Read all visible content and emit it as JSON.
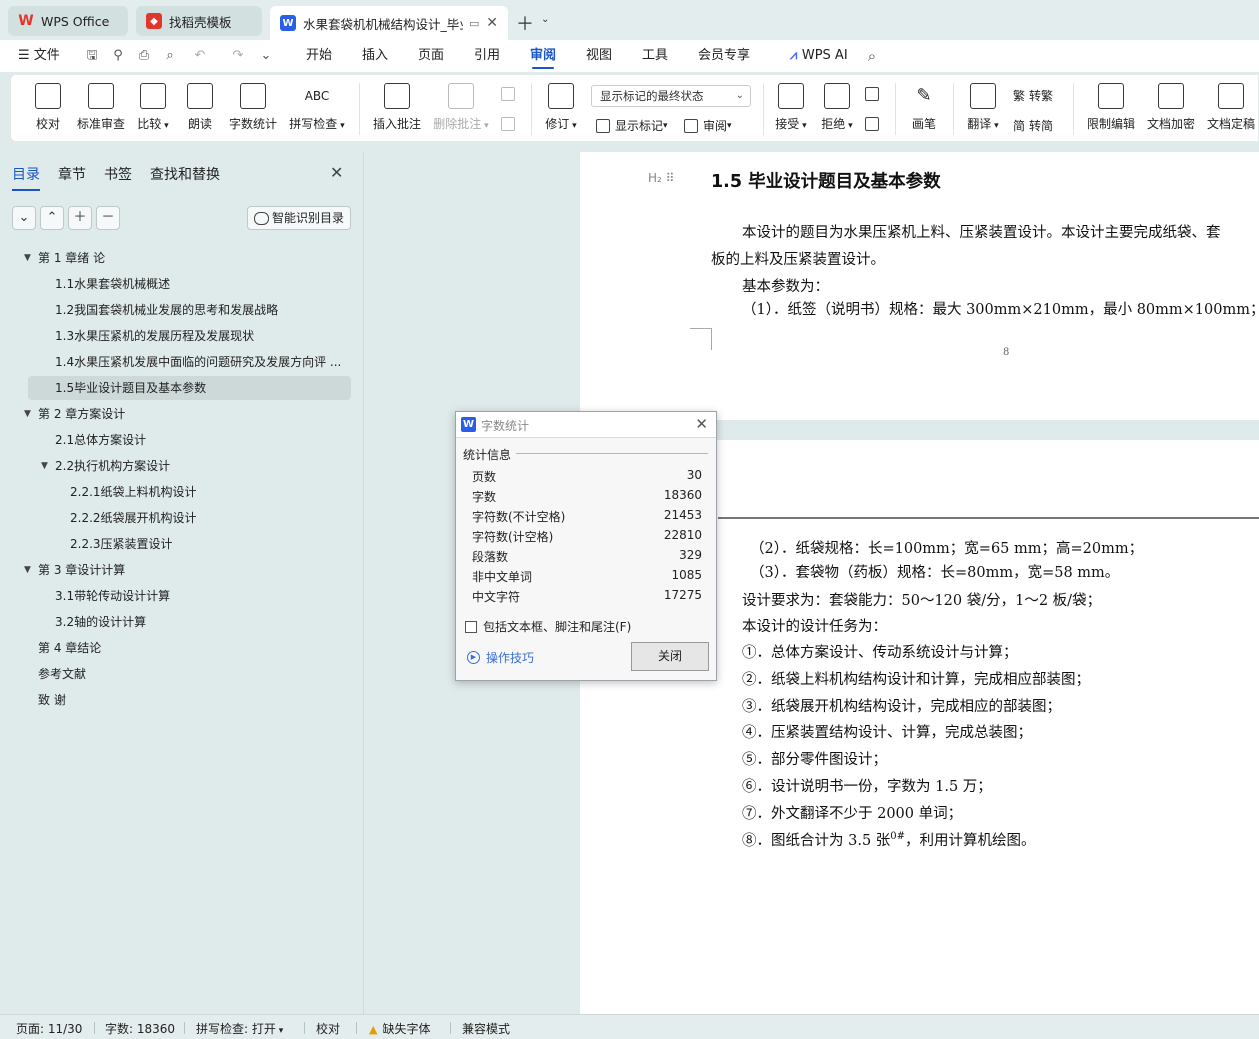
{
  "tabs": [
    {
      "label": "WPS Office",
      "icon": "wps-logo-icon"
    },
    {
      "label": "找稻壳模板",
      "icon": "docer-logo-icon"
    },
    {
      "label": "水果套袋机机械结构设计_毕业",
      "icon": "writer-logo-icon"
    }
  ],
  "menu": {
    "file": "文件",
    "items": [
      "开始",
      "插入",
      "页面",
      "引用",
      "审阅",
      "视图",
      "工具",
      "会员专享"
    ],
    "active": "审阅",
    "wps_ai": "WPS AI"
  },
  "ribbon": {
    "proofread": "校对",
    "standard_review": "标准审查",
    "compare": "比较",
    "read_aloud": "朗读",
    "word_count": "字数统计",
    "spell_check": "拼写检查",
    "insert_comment": "插入批注",
    "delete_comment": "删除批注",
    "track_changes": "修订",
    "display_state": "显示标记的最终状态",
    "show_markup": "显示标记",
    "review": "审阅",
    "accept": "接受",
    "reject": "拒绝",
    "pen": "画笔",
    "translate": "翻译",
    "to_traditional": "转繁",
    "to_simplified": "转简",
    "restrict_edit": "限制编辑",
    "doc_encrypt": "文档加密",
    "doc_finalize": "文档定稿"
  },
  "nav": {
    "tabs": [
      "目录",
      "章节",
      "书签",
      "查找和替换"
    ],
    "smart_toc": "智能识别目录",
    "toc": [
      {
        "label": "第 1 章绪  论",
        "level": 1,
        "caret": true
      },
      {
        "label": "1.1水果套袋机械概述",
        "level": 2
      },
      {
        "label": "1.2我国套袋机械业发展的思考和发展战略",
        "level": 2
      },
      {
        "label": "1.3水果压紧机的发展历程及发展现状",
        "level": 2
      },
      {
        "label": "1.4水果压紧机发展中面临的问题研究及发展方向评 ...",
        "level": 2
      },
      {
        "label": "1.5毕业设计题目及基本参数",
        "level": 2,
        "selected": true
      },
      {
        "label": "第 2 章方案设计",
        "level": 1,
        "caret": true
      },
      {
        "label": "2.1总体方案设计",
        "level": 2
      },
      {
        "label": "2.2执行机构方案设计",
        "level": 2,
        "caret": true
      },
      {
        "label": "2.2.1纸袋上料机构设计",
        "level": 3
      },
      {
        "label": "2.2.2纸袋展开机构设计",
        "level": 3
      },
      {
        "label": "2.2.3压紧装置设计",
        "level": 3
      },
      {
        "label": "第 3 章设计计算",
        "level": 1,
        "caret": true
      },
      {
        "label": "3.1带轮传动设计计算",
        "level": 2
      },
      {
        "label": "3.2轴的设计计算",
        "level": 2
      },
      {
        "label": "第 4 章结论",
        "level": 1
      },
      {
        "label": "参考文献",
        "level": 1
      },
      {
        "label": "致  谢",
        "level": 1
      }
    ]
  },
  "document": {
    "heading_mark": "H₂",
    "heading": "1.5  毕业设计题目及基本参数",
    "p1_line1": "本设计的题目为水果压紧机上料、压紧装置设计。本设计主要完成纸袋、套",
    "p1_line2": "板的上料及压紧装置设计。",
    "p2": "基本参数为：",
    "p3": "（1）．纸签（说明书）规格：最大 300mm×210mm，最小 80mm×100mm；",
    "page_number": "8",
    "page2_lines": [
      "（2）．纸袋规格：长=100mm；宽=65 mm；高=20mm；",
      "（3）．套袋物（药板）规格：长=80mm，宽=58 mm。",
      "设计要求为：套袋能力：50～120 袋/分，1～2 板/袋；",
      "本设计的设计任务为：",
      "①．总体方案设计、传动系统设计与计算；",
      "②．纸袋上料机构结构设计和计算，完成相应部装图；",
      "③．纸袋展开机构结构设计，完成相应的部装图；",
      "④．压紧装置结构设计、计算，完成总装图；",
      "⑤．部分零件图设计；",
      "⑥．设计说明书一份，字数为 1.5 万；",
      "⑦．外文翻译不少于 2000 单词；"
    ],
    "last_line_before": "⑧．图纸合计为 3.5 张",
    "last_line_sup": "0#",
    "last_line_after": "，利用计算机绘图。"
  },
  "dialog": {
    "title": "字数统计",
    "section": "统计信息",
    "stats": [
      {
        "label": "页数",
        "value": "30"
      },
      {
        "label": "字数",
        "value": "18360"
      },
      {
        "label": "字符数(不计空格)",
        "value": "21453"
      },
      {
        "label": "字符数(计空格)",
        "value": "22810"
      },
      {
        "label": "段落数",
        "value": "329"
      },
      {
        "label": "非中文单词",
        "value": "1085"
      },
      {
        "label": "中文字符",
        "value": "17275"
      }
    ],
    "checkbox": "包括文本框、脚注和尾注(F)",
    "tips": "操作技巧",
    "close": "关闭"
  },
  "status": {
    "page": "页面: 11/30",
    "words": "字数: 18360",
    "spell": "拼写检查: 打开",
    "proof": "校对",
    "missing_font": "缺失字体",
    "compat": "兼容模式"
  },
  "colors": {
    "accent": "#1a56c9",
    "wps_red": "#e0362c",
    "writer_blue": "#2b5ee6"
  }
}
